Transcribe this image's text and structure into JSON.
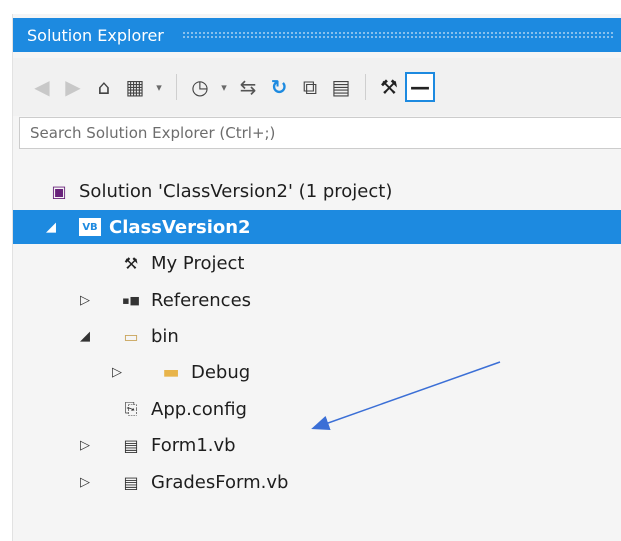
{
  "window": {
    "title": "Solution Explorer"
  },
  "toolbar": {
    "buttons": [
      {
        "icon": "back-icon"
      },
      {
        "icon": "forward-icon"
      },
      {
        "icon": "home-icon"
      },
      {
        "icon": "switch-views-icon"
      },
      {
        "icon": "dropdown-icon"
      },
      {
        "icon": "pending-changes-filter-icon"
      },
      {
        "icon": "dropdown-icon"
      },
      {
        "icon": "sync-with-active-document-icon"
      },
      {
        "icon": "refresh-icon"
      },
      {
        "icon": "collapse-all-icon"
      },
      {
        "icon": "show-all-files-icon"
      },
      {
        "icon": "properties-icon"
      },
      {
        "icon": "preview-selected-items-icon"
      }
    ],
    "glyphs": {
      "back": "◀",
      "forward": "▶",
      "home": "⌂",
      "switch": "▦",
      "dropdown": "▾",
      "clock": "◷",
      "sync": "⇆",
      "refresh": "↻",
      "collapse": "⧉",
      "showall": "▤",
      "wrench": "⚒",
      "preview": "—"
    }
  },
  "search": {
    "placeholder": "Search Solution Explorer (Ctrl+;)",
    "value": ""
  },
  "tree": {
    "items": [
      {
        "label": "Solution 'ClassVersion2' (1 project)",
        "icon": "solution-icon",
        "glyph": "▣",
        "expander": "",
        "selected": false
      },
      {
        "label": "ClassVersion2",
        "icon": "vb-project-icon",
        "glyph": "VB",
        "expander": "◢",
        "selected": true
      },
      {
        "label": "My Project",
        "icon": "wrench-icon",
        "glyph": "⚒",
        "expander": "",
        "selected": false
      },
      {
        "label": "References",
        "icon": "references-icon",
        "glyph": "▪■",
        "expander": "▷",
        "selected": false
      },
      {
        "label": "bin",
        "icon": "folder-open-icon",
        "glyph": "▭",
        "expander": "◢",
        "selected": false
      },
      {
        "label": "Debug",
        "icon": "folder-icon",
        "glyph": "▬",
        "expander": "▷",
        "selected": false
      },
      {
        "label": "App.config",
        "icon": "config-file-icon",
        "glyph": "⎘",
        "expander": "",
        "selected": false
      },
      {
        "label": "Form1.vb",
        "icon": "form-icon",
        "glyph": "▤",
        "expander": "▷",
        "selected": false
      },
      {
        "label": "GradesForm.vb",
        "icon": "form-icon",
        "glyph": "▤",
        "expander": "▷",
        "selected": false
      }
    ]
  },
  "colors": {
    "accent": "#1d8ae0",
    "annotation_arrow": "#3b6fd6",
    "folder": "#e8b44a"
  }
}
